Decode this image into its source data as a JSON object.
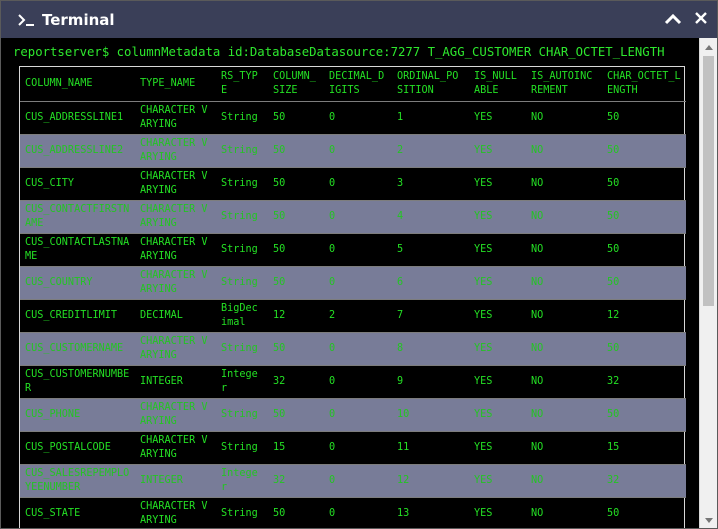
{
  "window": {
    "title": "Terminal",
    "icons": {
      "app": "terminal-prompt-icon",
      "collapse": "chevron-up-icon",
      "close": "close-icon"
    }
  },
  "terminal": {
    "command": "reportserver$ columnMetadata id:DatabaseDatasource:7277 T_AGG_CUSTOMER CHAR_OCTET_LENGTH"
  },
  "table": {
    "headers": [
      "COLUMN_NAME",
      "TYPE_NAME",
      "RS_TYPE",
      "COLUMN_SIZE",
      "DECIMAL_DIGITS",
      "ORDINAL_POSITION",
      "IS_NULLABLE",
      "IS_AUTOINCREMENT",
      "CHAR_OCTET_LENGTH"
    ],
    "rows": [
      [
        "CUS_ADDRESSLINE1",
        "CHARACTER VARYING",
        "String",
        "50",
        "0",
        "1",
        "YES",
        "NO",
        "50"
      ],
      [
        "CUS_ADDRESSLINE2",
        "CHARACTER VARYING",
        "String",
        "50",
        "0",
        "2",
        "YES",
        "NO",
        "50"
      ],
      [
        "CUS_CITY",
        "CHARACTER VARYING",
        "String",
        "50",
        "0",
        "3",
        "YES",
        "NO",
        "50"
      ],
      [
        "CUS_CONTACTFIRSTNAME",
        "CHARACTER VARYING",
        "String",
        "50",
        "0",
        "4",
        "YES",
        "NO",
        "50"
      ],
      [
        "CUS_CONTACTLASTNAME",
        "CHARACTER VARYING",
        "String",
        "50",
        "0",
        "5",
        "YES",
        "NO",
        "50"
      ],
      [
        "CUS_COUNTRY",
        "CHARACTER VARYING",
        "String",
        "50",
        "0",
        "6",
        "YES",
        "NO",
        "50"
      ],
      [
        "CUS_CREDITLIMIT",
        "DECIMAL",
        "BigDecimal",
        "12",
        "2",
        "7",
        "YES",
        "NO",
        "12"
      ],
      [
        "CUS_CUSTOMERNAME",
        "CHARACTER VARYING",
        "String",
        "50",
        "0",
        "8",
        "YES",
        "NO",
        "50"
      ],
      [
        "CUS_CUSTOMERNUMBER",
        "INTEGER",
        "Integer",
        "32",
        "0",
        "9",
        "YES",
        "NO",
        "32"
      ],
      [
        "CUS_PHONE",
        "CHARACTER VARYING",
        "String",
        "50",
        "0",
        "10",
        "YES",
        "NO",
        "50"
      ],
      [
        "CUS_POSTALCODE",
        "CHARACTER VARYING",
        "String",
        "15",
        "0",
        "11",
        "YES",
        "NO",
        "15"
      ],
      [
        "CUS_SALESREPEMPLOYEENUMBER",
        "INTEGER",
        "Integer",
        "32",
        "0",
        "12",
        "YES",
        "NO",
        "32"
      ],
      [
        "CUS_STATE",
        "CHARACTER VARYING",
        "String",
        "50",
        "0",
        "13",
        "YES",
        "NO",
        "50"
      ]
    ]
  },
  "colors": {
    "titlebar": "#3a3f58",
    "terminal_text": "#2ee82e",
    "alt_row": "#787c98",
    "background": "#000000"
  }
}
